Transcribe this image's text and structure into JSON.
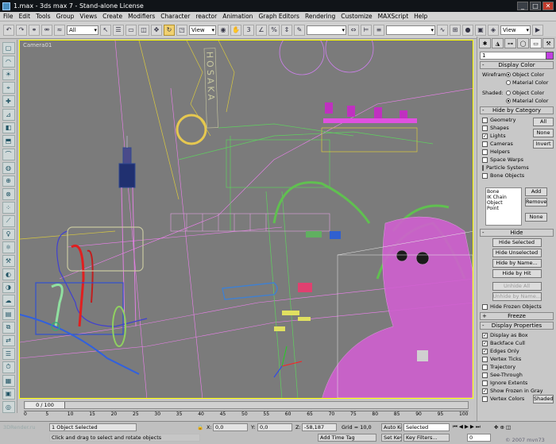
{
  "window": {
    "title": "1.max - 3ds max 7 - Stand-alone License",
    "min": "_",
    "max": "□",
    "close": "✕"
  },
  "menu": [
    "File",
    "Edit",
    "Tools",
    "Group",
    "Views",
    "Create",
    "Modifiers",
    "Character",
    "reactor",
    "Animation",
    "Graph Editors",
    "Rendering",
    "Customize",
    "MAXScript",
    "Help"
  ],
  "toolbar": {
    "selection_filter": "All",
    "ref_coord": "View",
    "named_sel": "",
    "view_right": "View"
  },
  "viewport": {
    "label": "Camera01",
    "sign_text": "HOSAKA"
  },
  "command_panel": {
    "name_value": "1",
    "display_color": {
      "title": "Display Color",
      "wireframe_label": "Wireframe:",
      "wireframe_options": [
        "Object Color",
        "Material Color"
      ],
      "wireframe_selected": "Object Color",
      "shaded_label": "Shaded:",
      "shaded_options": [
        "Object Color",
        "Material Color"
      ],
      "shaded_selected": "Material Color"
    },
    "hide_by_category": {
      "title": "Hide by Category",
      "items": [
        {
          "label": "Geometry",
          "checked": false
        },
        {
          "label": "Shapes",
          "checked": false
        },
        {
          "label": "Lights",
          "checked": true
        },
        {
          "label": "Cameras",
          "checked": false
        },
        {
          "label": "Helpers",
          "checked": false
        },
        {
          "label": "Space Warps",
          "checked": false
        },
        {
          "label": "Particle Systems",
          "checked": false
        },
        {
          "label": "Bone Objects",
          "checked": false
        }
      ],
      "btn_all": "All",
      "btn_none": "None",
      "btn_invert": "Invert",
      "list": [
        "Bone",
        "IK Chain Object",
        "Point"
      ],
      "btn_add": "Add",
      "btn_remove": "Remove",
      "btn_none2": "None"
    },
    "hide": {
      "title": "Hide",
      "buttons": [
        "Hide Selected",
        "Hide Unselected",
        "Hide by Name...",
        "Hide by Hit"
      ],
      "disabled_buttons": [
        "Unhide All",
        "Unhide by Name..."
      ],
      "frozen_label": "Hide Frozen Objects"
    },
    "freeze": {
      "title": "Freeze"
    },
    "display_properties": {
      "title": "Display Properties",
      "items": [
        {
          "label": "Display as Box",
          "checked": true
        },
        {
          "label": "Backface Cull",
          "checked": true
        },
        {
          "label": "Edges Only",
          "checked": true
        },
        {
          "label": "Vertex Ticks",
          "checked": false
        },
        {
          "label": "Trajectory",
          "checked": false
        },
        {
          "label": "See-Through",
          "checked": false
        },
        {
          "label": "Ignore Extents",
          "checked": false
        },
        {
          "label": "Show Frozen in Gray",
          "checked": true
        },
        {
          "label": "Vertex Colors",
          "checked": false
        }
      ],
      "shaded_btn": "Shaded"
    }
  },
  "timeline": {
    "slider_label": "0 / 100",
    "ticks": [
      "0",
      "5",
      "10",
      "15",
      "20",
      "25",
      "30",
      "35",
      "40",
      "45",
      "50",
      "55",
      "60",
      "65",
      "70",
      "75",
      "80",
      "85",
      "90",
      "95",
      "100"
    ]
  },
  "status": {
    "selection": "1 Object Selected",
    "prompt": "Click and drag to select and rotate objects",
    "x_label": "X:",
    "x_value": "0,0",
    "y_label": "Y:",
    "y_value": "0,0",
    "z_label": "Z:",
    "z_value": "-58,187",
    "grid": "Grid = 10,0",
    "add_time_tag": "Add Time Tag",
    "auto_key": "Auto Key",
    "set_key": "Set Key",
    "key_mode": "Selected",
    "key_filters": "Key Filters...",
    "frame": "0",
    "watermark_left": "3DRender.ru",
    "watermark_right": "© 2007 mvn73"
  },
  "colors": {
    "viewport_bg": "#7b7b7b",
    "active_border": "#ffff00",
    "title_bg": "#101418"
  }
}
